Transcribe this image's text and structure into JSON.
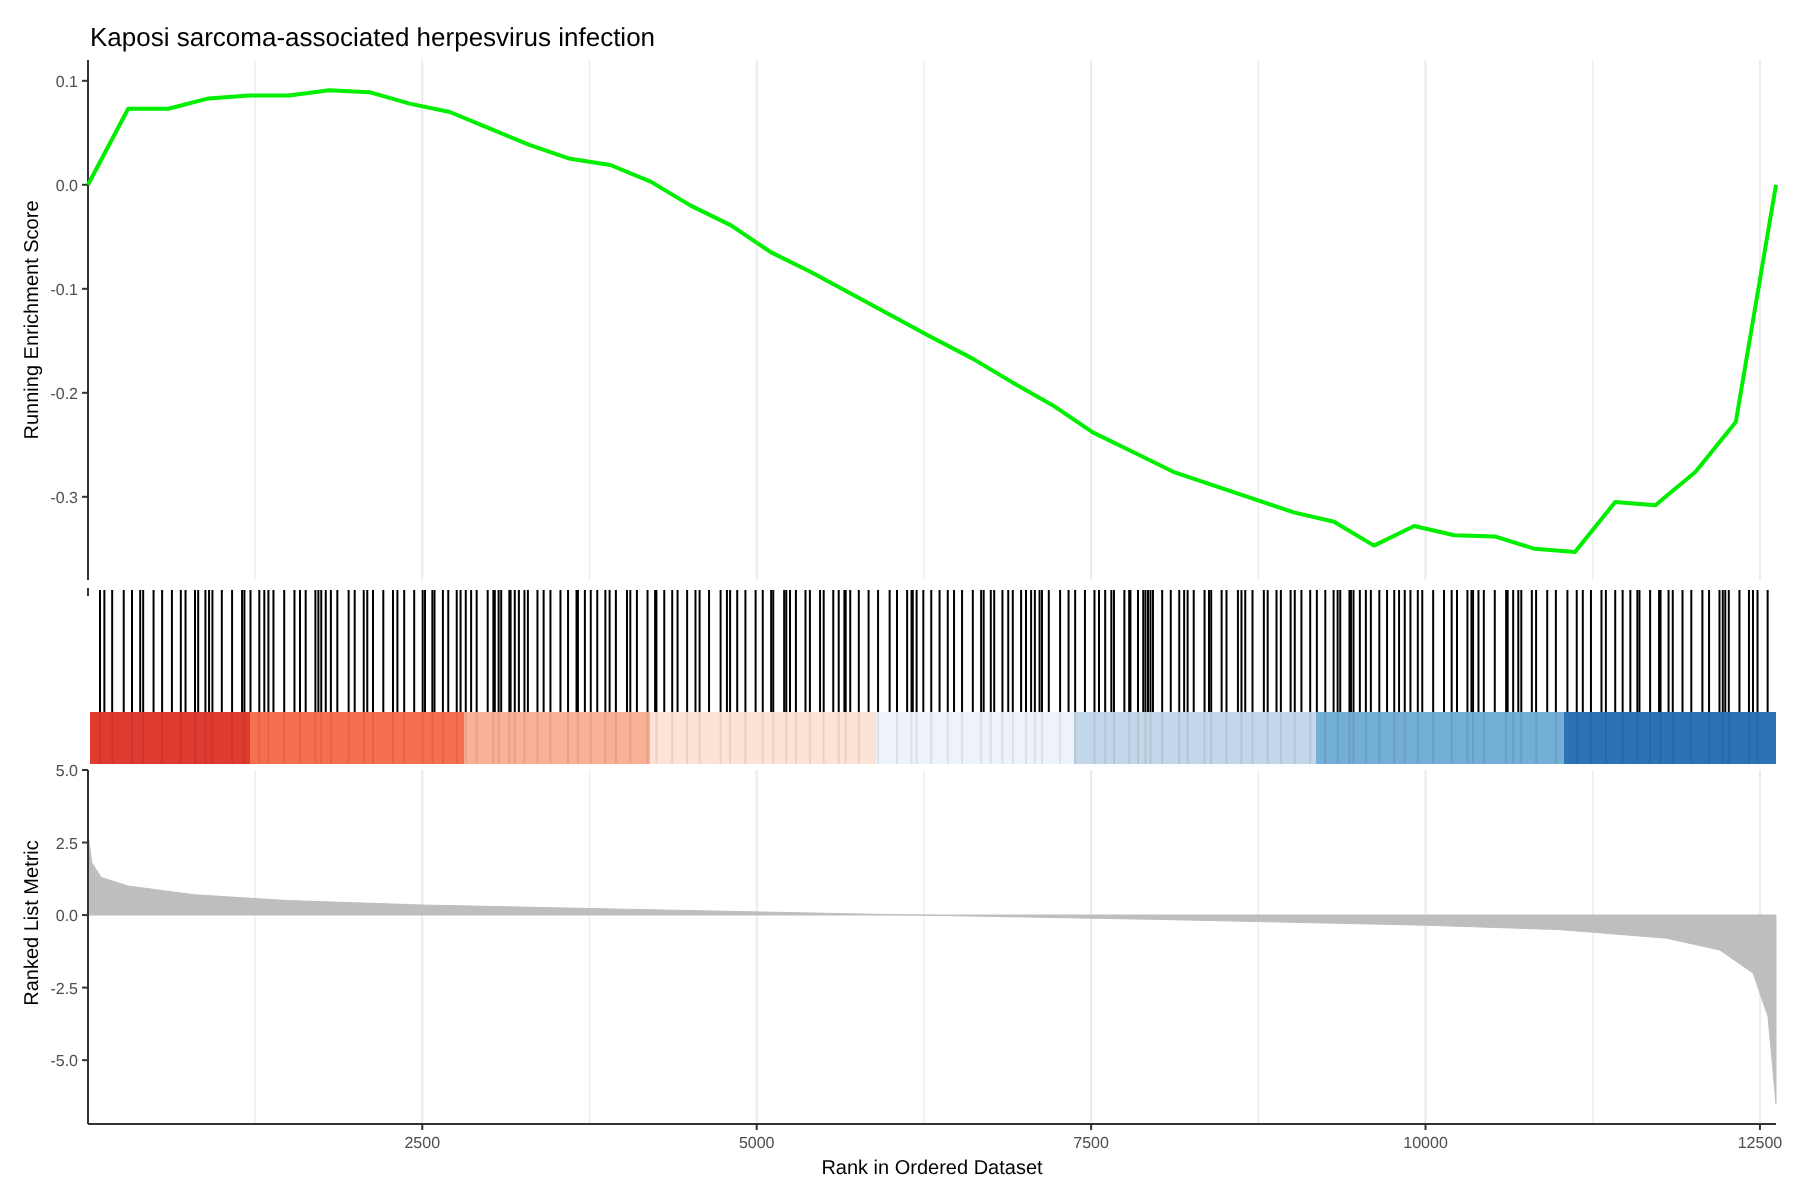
{
  "title": "Kaposi sarcoma-associated herpesvirus infection",
  "enrichment_plot": {
    "chart_data": {
      "type": "line",
      "ylabel": "Running Enrichment Score",
      "series": [
        {
          "color": "#00ee00",
          "values": [
            0,
            0.073,
            0.073,
            0.083,
            0.086,
            0.086,
            0.091,
            0.089,
            0.078,
            0.07,
            0.054,
            0.038,
            0.025,
            0.019,
            0.003,
            -0.02,
            -0.039,
            -0.065,
            -0.084,
            -0.105,
            -0.126,
            -0.147,
            -0.167,
            -0.19,
            -0.212,
            -0.238,
            -0.257,
            -0.276,
            -0.289,
            -0.302,
            -0.315,
            -0.324,
            -0.347,
            -0.328,
            -0.337,
            -0.338,
            -0.35,
            -0.353,
            -0.305,
            -0.308,
            -0.276,
            -0.228,
            0
          ]
        }
      ],
      "ylim": [
        -0.38,
        0.12
      ],
      "grid": true,
      "yticks": [
        {
          "value": 0.1,
          "label": "0.1"
        },
        {
          "value": 0,
          "label": "0.0"
        },
        {
          "value": -0.1,
          "label": "-0.1"
        },
        {
          "value": -0.2,
          "label": "-0.2"
        },
        {
          "value": -0.3,
          "label": "-0.3"
        }
      ]
    }
  },
  "metric_plot": {
    "chart_data": {
      "type": "area",
      "xlabel": "Rank in Ordered Dataset",
      "ylabel": "Ranked List Metric",
      "x": [
        1,
        30,
        100,
        300,
        800,
        1500,
        2500,
        4000,
        6000,
        8000,
        10000,
        11000,
        11800,
        12200,
        12450,
        12560,
        12620
      ],
      "series": [
        {
          "color": "#bebebe",
          "values": [
            2.8,
            1.8,
            1.3,
            1.0,
            0.7,
            0.5,
            0.35,
            0.2,
            0.02,
            -0.15,
            -0.35,
            -0.5,
            -0.8,
            -1.2,
            -2,
            -3.5,
            -6.5
          ]
        }
      ],
      "xlim": [
        1,
        12620
      ],
      "ylim": [
        -7.2,
        5
      ],
      "grid": true,
      "xticks": [
        2500,
        5000,
        7500,
        10000,
        12500
      ],
      "yticks": [
        {
          "value": 5,
          "label": "5.0"
        },
        {
          "value": 2.5,
          "label": "2.5"
        },
        {
          "value": 0,
          "label": "0.0"
        },
        {
          "value": -2.5,
          "label": "-2.5"
        },
        {
          "value": -5,
          "label": "-5.0"
        }
      ]
    }
  }
}
